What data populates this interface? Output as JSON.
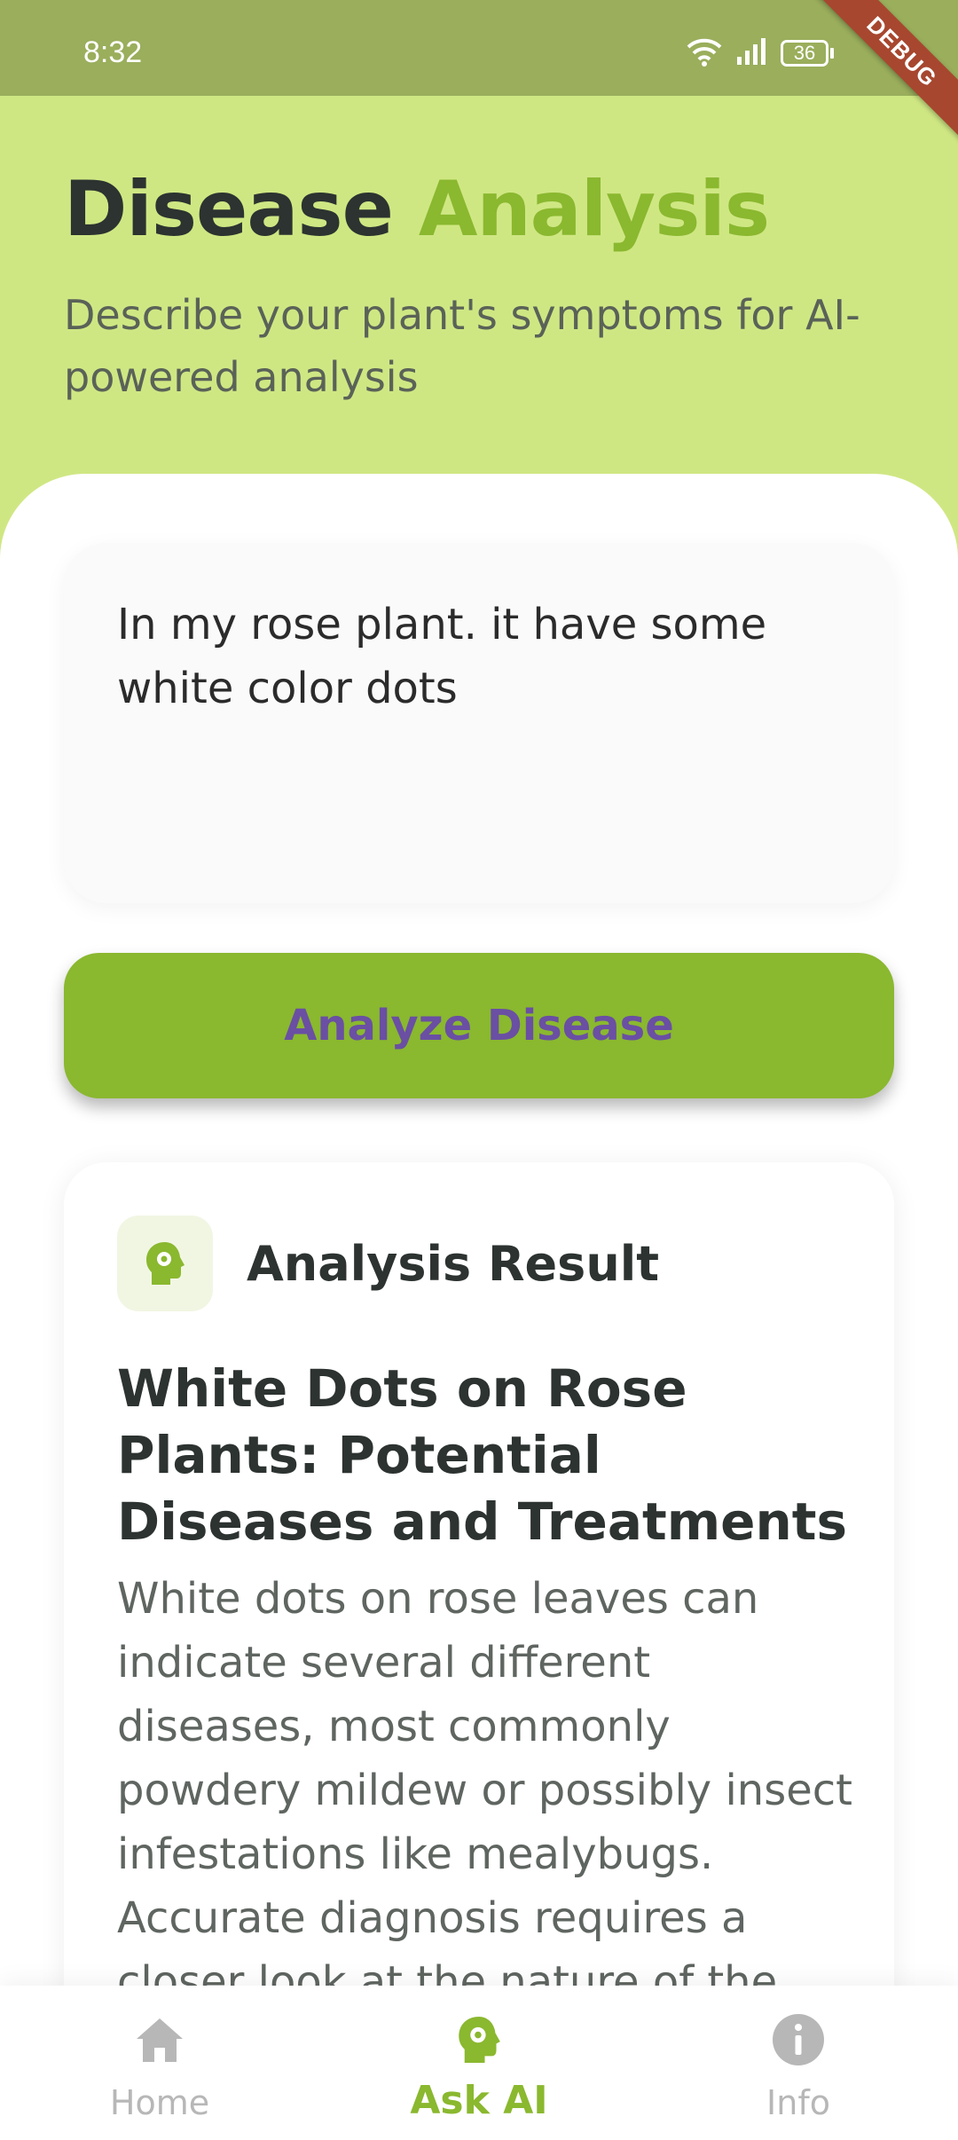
{
  "status_bar": {
    "time": "8:32",
    "battery": "36",
    "debug_label": "DEBUG"
  },
  "header": {
    "title_part1": "Disease",
    "title_part2": "Analysis",
    "subtitle": "Describe your plant's symptoms for AI-powered analysis"
  },
  "input": {
    "value": "In my rose plant. it have some white color dots"
  },
  "analyze_button": {
    "label": "Analyze Disease"
  },
  "result": {
    "label": "Analysis Result",
    "title": "White Dots on Rose Plants: Potential Diseases and Treatments",
    "body": "White dots on rose leaves can indicate several different diseases, most commonly powdery mildew or possibly insect infestations like mealybugs.  Accurate diagnosis requires a closer look at the nature of the dots and their location on"
  },
  "bottom_nav": {
    "items": [
      {
        "label": "Home",
        "icon": "home-icon"
      },
      {
        "label": "Ask AI",
        "icon": "ai-head-icon"
      },
      {
        "label": "Info",
        "icon": "info-icon"
      }
    ],
    "active": "Ask AI"
  },
  "colors": {
    "accent": "#8ab82f",
    "header_bg": "#cfe783",
    "status_bar_bg": "#9aae5c",
    "button_text": "#6a4fa3",
    "inactive_nav": "#b7b7b7"
  }
}
